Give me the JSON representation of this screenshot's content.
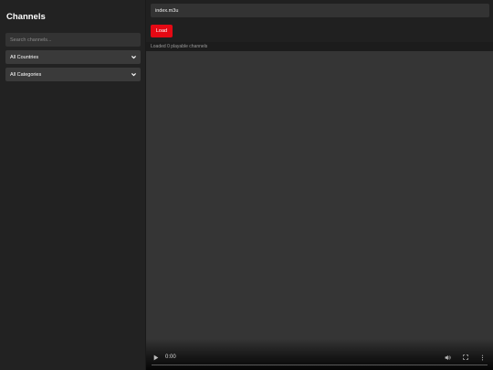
{
  "sidebar": {
    "title": "Channels",
    "search_placeholder": "Search channels...",
    "country_select": "All Countries",
    "category_select": "All Categories"
  },
  "toolbar": {
    "url_value": "index.m3u",
    "load_label": "Load",
    "status_text": "Loaded 0 playable channels"
  },
  "player": {
    "time": "0:00",
    "progress": 0
  },
  "colors": {
    "accent": "#e50914",
    "sidebar_bg": "#222222",
    "video_bg": "#353535"
  }
}
